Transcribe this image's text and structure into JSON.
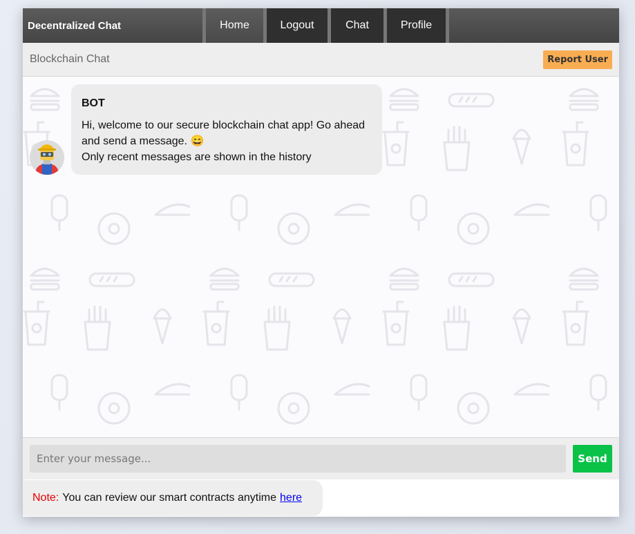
{
  "navbar": {
    "brand": "Decentralized Chat",
    "items": [
      {
        "label": "Home"
      },
      {
        "label": "Logout"
      },
      {
        "label": "Chat"
      },
      {
        "label": "Profile"
      }
    ]
  },
  "chat_header": {
    "title": "Blockchain Chat",
    "report_label": "Report User"
  },
  "messages": [
    {
      "sender": "BOT",
      "avatar": "robot-worker-avatar",
      "line1": "Hi, welcome to our secure blockchain chat app! Go ahead and send a message.",
      "emoji": "😄",
      "line2": "Only recent messages are shown in the history"
    }
  ],
  "composer": {
    "placeholder": "Enter your message...",
    "send_label": "Send"
  },
  "note": {
    "label": "Note:",
    "text": "You can review our smart contracts anytime",
    "link_text": "here"
  },
  "colors": {
    "send": "#0ac248",
    "report": "#f9ad52",
    "note_label": "#e60000",
    "navbar": "#444444"
  }
}
